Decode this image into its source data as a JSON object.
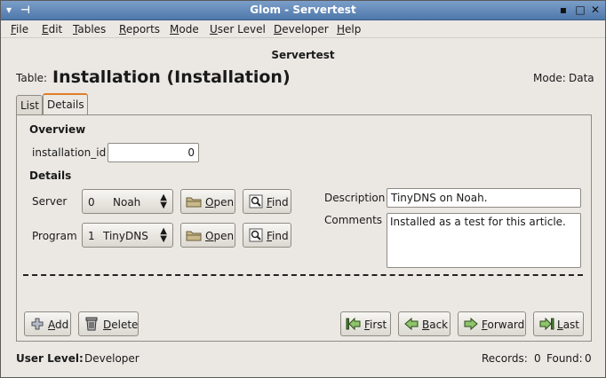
{
  "window": {
    "title": "Glom - Servertest",
    "controls": [
      "minimize-icon",
      "maximize-icon",
      "close-icon"
    ]
  },
  "menubar": {
    "items": [
      {
        "mnemonic": "F",
        "rest": "ile"
      },
      {
        "mnemonic": "E",
        "rest": "dit"
      },
      {
        "mnemonic": "T",
        "rest": "ables"
      },
      {
        "mnemonic": "R",
        "rest": "eports"
      },
      {
        "mnemonic": "M",
        "rest": "ode"
      },
      {
        "mnemonic": "U",
        "rest": "ser Level"
      },
      {
        "mnemonic": "D",
        "rest": "eveloper"
      },
      {
        "mnemonic": "H",
        "rest": "elp"
      }
    ]
  },
  "header": {
    "app_title": "Servertest",
    "table_label": "Table:",
    "table_title": "Installation (Installation)",
    "mode_label": "Mode:",
    "mode_value": "Data"
  },
  "tabs": [
    {
      "label": "List",
      "active": false
    },
    {
      "label": "Details",
      "active": true
    }
  ],
  "overview": {
    "heading": "Overview",
    "installation_id_label": "installation_id",
    "installation_id_value": "0"
  },
  "details": {
    "heading": "Details",
    "server": {
      "label": "Server",
      "id": "0",
      "value": "Noah"
    },
    "program": {
      "label": "Program",
      "id": "1",
      "value": "TinyDNS"
    },
    "open_label": "Open",
    "find_label": "Find",
    "description_label": "Description",
    "description_value": "TinyDNS on Noah.",
    "comments_label": "Comments",
    "comments_value": "Installed as a test for this article."
  },
  "actions": {
    "add": "Add",
    "delete": "Delete",
    "first": "First",
    "back": "Back",
    "forward": "Forward",
    "last": "Last"
  },
  "status": {
    "user_level_label": "User Level:",
    "user_level_value": "Developer",
    "records_label": "Records:",
    "records_value": "0",
    "found_label": "Found:",
    "found_value": "0"
  },
  "colors": {
    "titlebar": "#4e77aa",
    "window_bg": "#ebe8e3",
    "active_tab_accent": "#e07c2a"
  }
}
